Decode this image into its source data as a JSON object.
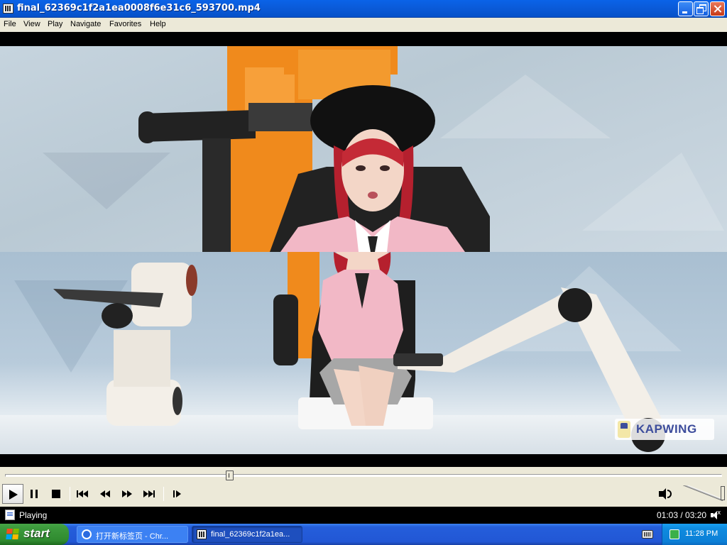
{
  "window": {
    "title": "final_62369c1f2a1ea0008f6e31c6_593700.mp4"
  },
  "menu": [
    "File",
    "View",
    "Play",
    "Navigate",
    "Favorites",
    "Help"
  ],
  "video": {
    "watermark": "KAPWING",
    "playback_progress": 0.3125
  },
  "controls": {
    "icons": [
      "play-icon",
      "pause-icon",
      "stop-icon",
      "previous-icon",
      "rewind-icon",
      "fast-forward-icon",
      "next-icon",
      "step-frame-icon",
      "volume-icon"
    ],
    "volume_level": 1.0
  },
  "status": {
    "state": "Playing",
    "time": "01:03 / 03:20"
  },
  "taskbar": {
    "start_label": "start",
    "tasks": [
      {
        "label": "打开新标签页 - Chr..."
      },
      {
        "label": "final_62369c1f2a1ea..."
      }
    ],
    "clock": "11:28 PM"
  },
  "colors": {
    "titlebar": "#0a5ad8",
    "chrome": "#ece9d8",
    "taskbar": "#245edb",
    "start_button": "#3c9a3c",
    "watermark_text": "#3d4d9c"
  }
}
